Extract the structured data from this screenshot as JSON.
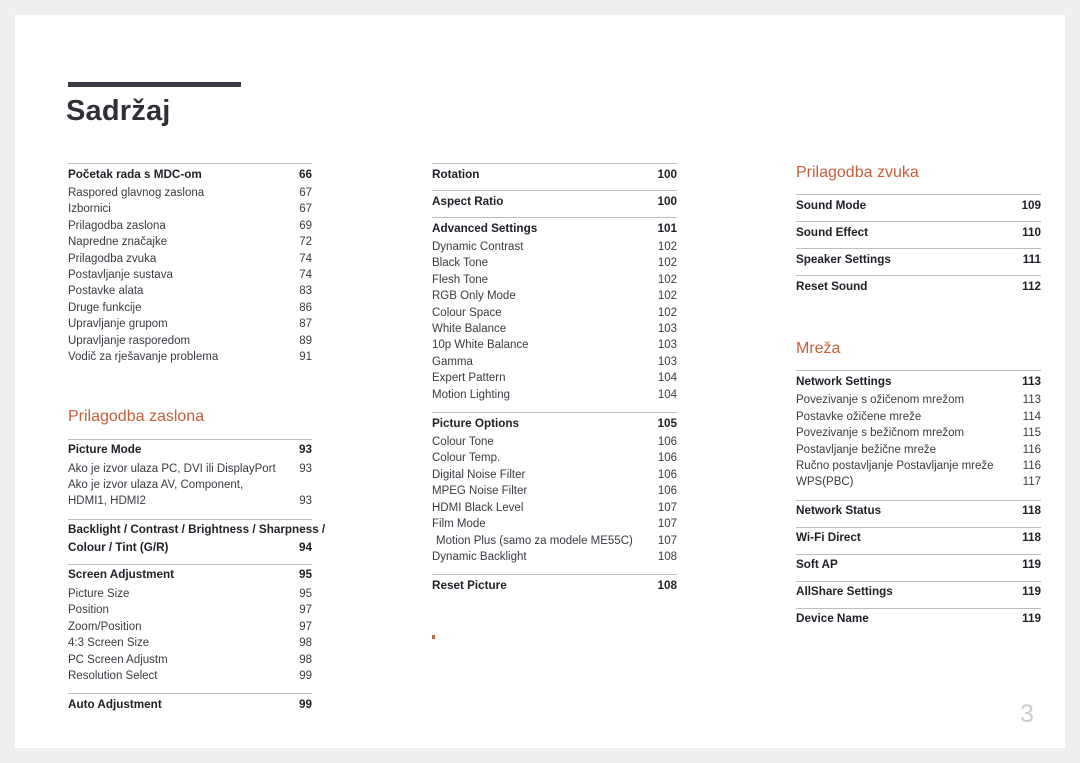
{
  "document": {
    "title": "Sadržaj",
    "folio": "3",
    "accent_color": "#c45f3b",
    "rule_color": "#3b3b46",
    "text_color": "#33333b",
    "page_background": "#ffffff",
    "canvas_background": "#efefef"
  },
  "columns": [
    {
      "name": "column-1",
      "groups": [
        {
          "type": "toc-group",
          "rows": [
            {
              "label": "Početak rada s MDC-om",
              "page": "66",
              "level": "major"
            },
            {
              "label": "Raspored glavnog zaslona",
              "page": "67",
              "level": "minor"
            },
            {
              "label": "Izbornici",
              "page": "67",
              "level": "minor"
            },
            {
              "label": "Prilagodba zaslona",
              "page": "69",
              "level": "minor"
            },
            {
              "label": "Napredne značajke",
              "page": "72",
              "level": "minor"
            },
            {
              "label": "Prilagodba zvuka",
              "page": "74",
              "level": "minor"
            },
            {
              "label": "Postavljanje sustava",
              "page": "74",
              "level": "minor"
            },
            {
              "label": "Postavke alata",
              "page": "83",
              "level": "minor"
            },
            {
              "label": "Druge funkcije",
              "page": "86",
              "level": "minor"
            },
            {
              "label": "Upravljanje grupom",
              "page": "87",
              "level": "minor"
            },
            {
              "label": "Upravljanje rasporedom",
              "page": "89",
              "level": "minor"
            },
            {
              "label": "Vodič za rješavanje problema",
              "page": "91",
              "level": "minor"
            }
          ]
        },
        {
          "type": "section-heading",
          "heading": "Prilagodba zaslona"
        },
        {
          "type": "toc-group",
          "rows": [
            {
              "label": "Picture Mode",
              "page": "93",
              "level": "major"
            },
            {
              "label": "Ako je izvor ulaza PC, DVI ili DisplayPort",
              "page": "93",
              "level": "minor"
            },
            {
              "line1": "Ako je izvor ulaza AV, Component,",
              "label": "HDMI1, HDMI2",
              "page": "93",
              "level": "minor-wrap"
            }
          ]
        },
        {
          "type": "toc-group",
          "rows": [
            {
              "line1": "Backlight / Contrast / Brightness / Sharpness /",
              "label": "Colour / Tint (G/R)",
              "page": "94",
              "level": "major-wrap"
            }
          ]
        },
        {
          "type": "toc-group",
          "rows": [
            {
              "label": "Screen Adjustment",
              "page": "95",
              "level": "major"
            },
            {
              "label": "Picture Size",
              "page": "95",
              "level": "minor"
            },
            {
              "label": "Position",
              "page": "97",
              "level": "minor"
            },
            {
              "label": "Zoom/Position",
              "page": "97",
              "level": "minor"
            },
            {
              "label": "4:3 Screen Size",
              "page": "98",
              "level": "minor"
            },
            {
              "label": "PC Screen Adjustm",
              "page": "98",
              "level": "minor"
            },
            {
              "label": "Resolution Select",
              "page": "99",
              "level": "minor"
            }
          ]
        },
        {
          "type": "toc-group",
          "rows": [
            {
              "label": "Auto Adjustment",
              "page": "99",
              "level": "major"
            }
          ]
        }
      ]
    },
    {
      "name": "column-2",
      "groups": [
        {
          "type": "toc-group",
          "rows": [
            {
              "label": "Rotation",
              "page": "100",
              "level": "major"
            }
          ]
        },
        {
          "type": "toc-group",
          "rows": [
            {
              "label": "Aspect Ratio",
              "page": "100",
              "level": "major"
            }
          ]
        },
        {
          "type": "toc-group",
          "rows": [
            {
              "label": "Advanced Settings",
              "page": "101",
              "level": "major"
            },
            {
              "label": "Dynamic Contrast",
              "page": "102",
              "level": "minor"
            },
            {
              "label": "Black Tone",
              "page": "102",
              "level": "minor"
            },
            {
              "label": "Flesh Tone",
              "page": "102",
              "level": "minor"
            },
            {
              "label": "RGB Only Mode",
              "page": "102",
              "level": "minor"
            },
            {
              "label": "Colour Space",
              "page": "102",
              "level": "minor"
            },
            {
              "label": "White Balance",
              "page": "103",
              "level": "minor"
            },
            {
              "label": "10p White Balance",
              "page": "103",
              "level": "minor"
            },
            {
              "label": "Gamma",
              "page": "103",
              "level": "minor"
            },
            {
              "label": "Expert Pattern",
              "page": "104",
              "level": "minor"
            },
            {
              "label": "Motion Lighting",
              "page": "104",
              "level": "minor"
            }
          ]
        },
        {
          "type": "toc-group",
          "rows": [
            {
              "label": "Picture Options",
              "page": "105",
              "level": "major"
            },
            {
              "label": "Colour Tone",
              "page": "106",
              "level": "minor"
            },
            {
              "label": "Colour Temp.",
              "page": "106",
              "level": "minor"
            },
            {
              "label": "Digital Noise Filter",
              "page": "106",
              "level": "minor"
            },
            {
              "label": "MPEG Noise Filter",
              "page": "106",
              "level": "minor"
            },
            {
              "label": "HDMI Black Level",
              "page": "107",
              "level": "minor"
            },
            {
              "label": "Film Mode",
              "page": "107",
              "level": "minor"
            },
            {
              "label": "Motion Plus (samo za modele ME55C)",
              "page": "107",
              "level": "minor-indent"
            },
            {
              "label": "Dynamic Backlight",
              "page": "108",
              "level": "minor"
            }
          ]
        },
        {
          "type": "toc-group",
          "rows": [
            {
              "label": "Reset Picture",
              "page": "108",
              "level": "major"
            }
          ]
        }
      ]
    },
    {
      "name": "column-3",
      "groups": [
        {
          "type": "section-heading",
          "heading": "Prilagodba zvuka"
        },
        {
          "type": "toc-group",
          "rows": [
            {
              "label": "Sound Mode",
              "page": "109",
              "level": "major"
            }
          ]
        },
        {
          "type": "toc-group",
          "rows": [
            {
              "label": "Sound Effect",
              "page": "110",
              "level": "major"
            }
          ]
        },
        {
          "type": "toc-group",
          "rows": [
            {
              "label": "Speaker Settings",
              "page": "111",
              "level": "major"
            }
          ]
        },
        {
          "type": "toc-group",
          "rows": [
            {
              "label": "Reset Sound",
              "page": "112",
              "level": "major"
            }
          ]
        },
        {
          "type": "section-heading",
          "heading": "Mreža"
        },
        {
          "type": "toc-group",
          "rows": [
            {
              "label": "Network Settings",
              "page": "113",
              "level": "major"
            },
            {
              "label": "Povezivanje s ožičenom mrežom",
              "page": "113",
              "level": "minor"
            },
            {
              "label": "Postavke ožičene mreže",
              "page": "114",
              "level": "minor"
            },
            {
              "label": "Povezivanje s bežičnom mrežom",
              "page": "115",
              "level": "minor"
            },
            {
              "label": "Postavljanje bežične mreže",
              "page": "116",
              "level": "minor"
            },
            {
              "label": "Ručno postavljanje Postavljanje mreže",
              "page": "116",
              "level": "minor"
            },
            {
              "label": "WPS(PBC)",
              "page": "117",
              "level": "minor"
            }
          ]
        },
        {
          "type": "toc-group",
          "rows": [
            {
              "label": "Network Status",
              "page": "118",
              "level": "major"
            }
          ]
        },
        {
          "type": "toc-group",
          "rows": [
            {
              "label": "Wi-Fi Direct",
              "page": "118",
              "level": "major"
            }
          ]
        },
        {
          "type": "toc-group",
          "rows": [
            {
              "label": "Soft AP",
              "page": "119",
              "level": "major"
            }
          ]
        },
        {
          "type": "toc-group",
          "rows": [
            {
              "label": "AllShare Settings",
              "page": "119",
              "level": "major"
            }
          ]
        },
        {
          "type": "toc-group",
          "rows": [
            {
              "label": "Device Name",
              "page": "119",
              "level": "major"
            }
          ]
        }
      ]
    }
  ]
}
